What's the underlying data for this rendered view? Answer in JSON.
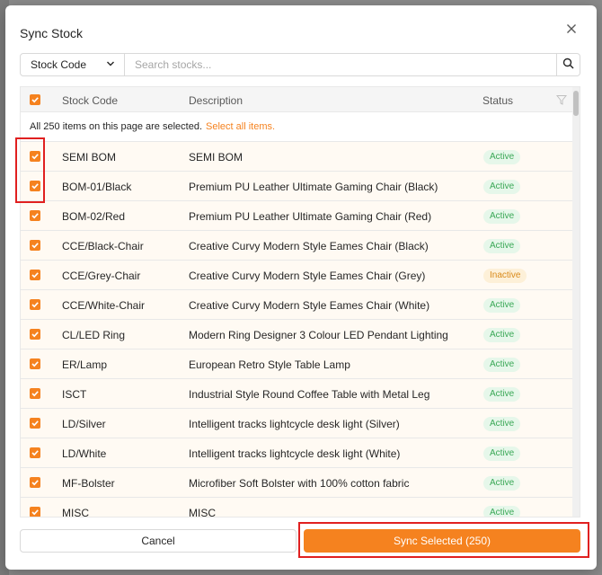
{
  "modal": {
    "title": "Sync Stock"
  },
  "search": {
    "field_value": "Stock Code",
    "placeholder": "Search stocks...",
    "value": ""
  },
  "table": {
    "headers": {
      "code": "Stock Code",
      "description": "Description",
      "status": "Status"
    },
    "selection_note": "All 250 items on this page are selected.",
    "select_all_link": "Select all items.",
    "rows": [
      {
        "code": "SEMI BOM",
        "description": "SEMI BOM",
        "status": "Active",
        "checked": true
      },
      {
        "code": "BOM-01/Black",
        "description": "Premium PU Leather Ultimate Gaming Chair (Black)",
        "status": "Active",
        "checked": true
      },
      {
        "code": "BOM-02/Red",
        "description": "Premium PU Leather Ultimate Gaming Chair (Red)",
        "status": "Active",
        "checked": true
      },
      {
        "code": "CCE/Black-Chair",
        "description": "Creative Curvy Modern Style Eames Chair (Black)",
        "status": "Active",
        "checked": true
      },
      {
        "code": "CCE/Grey-Chair",
        "description": "Creative Curvy Modern Style Eames Chair (Grey)",
        "status": "Inactive",
        "checked": true
      },
      {
        "code": "CCE/White-Chair",
        "description": "Creative Curvy Modern Style Eames Chair (White)",
        "status": "Active",
        "checked": true
      },
      {
        "code": "CL/LED Ring",
        "description": "Modern Ring Designer 3 Colour LED Pendant Lighting",
        "status": "Active",
        "checked": true
      },
      {
        "code": "ER/Lamp",
        "description": "European Retro Style Table Lamp",
        "status": "Active",
        "checked": true
      },
      {
        "code": "ISCT",
        "description": "Industrial Style Round Coffee Table with Metal Leg",
        "status": "Active",
        "checked": true
      },
      {
        "code": "LD/Silver",
        "description": "Intelligent tracks lightcycle desk light (Silver)",
        "status": "Active",
        "checked": true
      },
      {
        "code": "LD/White",
        "description": "Intelligent tracks lightcycle desk light (White)",
        "status": "Active",
        "checked": true
      },
      {
        "code": "MF-Bolster",
        "description": "Microfiber Soft Bolster with 100% cotton fabric",
        "status": "Active",
        "checked": true
      },
      {
        "code": "MISC",
        "description": "MISC",
        "status": "Active",
        "checked": true
      }
    ]
  },
  "footer": {
    "cancel_label": "Cancel",
    "sync_label": "Sync Selected (250)"
  },
  "colors": {
    "accent": "#f5821f",
    "active_text": "#3aa856",
    "inactive_text": "#d98a1a",
    "highlight": "#e02020"
  }
}
